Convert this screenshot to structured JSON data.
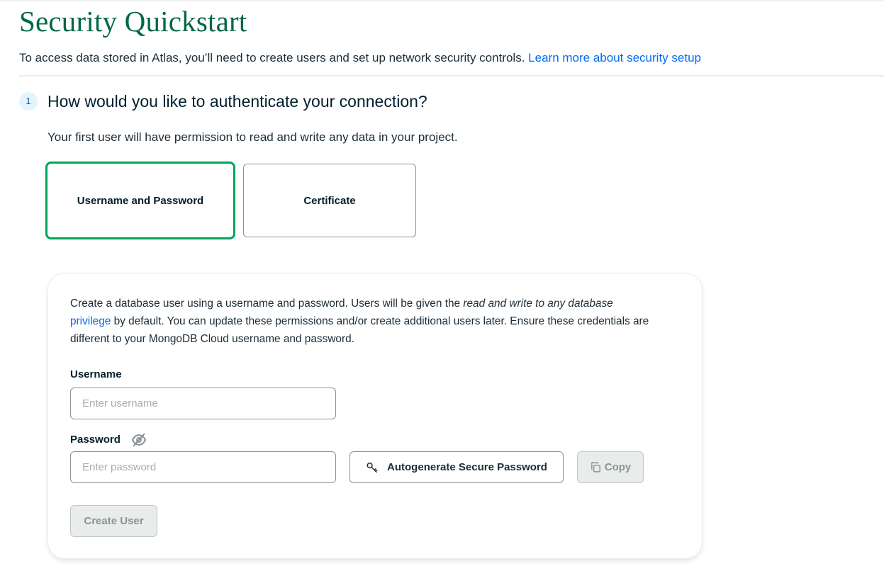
{
  "header": {
    "title": "Security Quickstart",
    "intro_text": "To access data stored in Atlas, you’ll need to create users and set up network security controls.",
    "intro_link": "Learn more about security setup"
  },
  "step": {
    "number": "1",
    "title": "How would you like to authenticate your connection?",
    "description": "Your first user will have permission to read and write any data in your project."
  },
  "auth_options": [
    {
      "label": "Username and Password",
      "selected": true
    },
    {
      "label": "Certificate",
      "selected": false
    }
  ],
  "form": {
    "text_part1": "Create a database user using a username and password. Users will be given the ",
    "text_italic": "read and write to any database",
    "text_link": "privilege",
    "text_part2": " by default. You can update these permissions and/or create additional users later. Ensure these credentials are different to your MongoDB Cloud username and password.",
    "username_label": "Username",
    "username_placeholder": "Enter username",
    "username_value": "",
    "password_label": "Password",
    "password_placeholder": "Enter password",
    "password_value": "",
    "autogen_label": "Autogenerate Secure Password",
    "copy_label": "Copy",
    "create_label": "Create User"
  },
  "icons": {
    "password_visibility": "eye-slash-icon",
    "autogenerate": "key-icon",
    "copy": "copy-icon"
  },
  "colors": {
    "brand_green": "#00684a",
    "selected_border": "#00a35c",
    "link_blue": "#016bf8",
    "disabled_text": "#889397"
  }
}
